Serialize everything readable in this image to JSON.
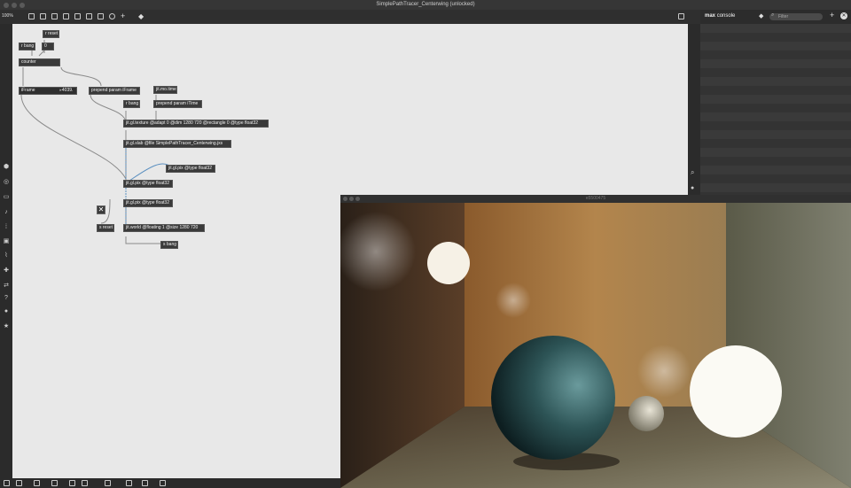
{
  "window": {
    "title": "SimplePathTracer_Centerwing (unlocked)"
  },
  "toolbar": {
    "zoom": "100%"
  },
  "console": {
    "title_bold": "max",
    "title_rest": "console",
    "filter_placeholder": "Filter"
  },
  "patch": {
    "objects": [
      {
        "name": "r-reset",
        "text": "r reset"
      },
      {
        "name": "r-bang-1",
        "text": "r bang"
      },
      {
        "name": "number-0",
        "text": "0"
      },
      {
        "name": "counter",
        "text": "counter"
      },
      {
        "name": "iframe-label",
        "text": "iFrame"
      },
      {
        "name": "iframe-value",
        "text": "4039."
      },
      {
        "name": "prepend-iframe",
        "text": "prepend param iFrame"
      },
      {
        "name": "jit-mo-time",
        "text": "jit.mo.time"
      },
      {
        "name": "r-bang-2",
        "text": "r bang"
      },
      {
        "name": "prepend-itime",
        "text": "prepend param iTime"
      },
      {
        "name": "jit-gl-texture",
        "text": "jit.gl.texture @adapt 0 @dim 1280 720 @rectangle 0 @type float32"
      },
      {
        "name": "jit-gl-slab",
        "text": "jit.gl.slab @file SimplePathTracer_Centerwing.jxs"
      },
      {
        "name": "jit-gl-pix-1",
        "text": "jit.gl.pix @type float32"
      },
      {
        "name": "jit-gl-pix-2",
        "text": "jit.gl.pix @type float32"
      },
      {
        "name": "jit-gl-pix-3",
        "text": "jit.gl.pix @type float32"
      },
      {
        "name": "s-reset",
        "text": "s reset"
      },
      {
        "name": "jit-world",
        "text": "jit.world @floating 1 @size 1280 720"
      },
      {
        "name": "s-bang",
        "text": "s bang"
      }
    ]
  },
  "render_window": {
    "title": "e5500475"
  },
  "colors": {
    "canvas": "#e8e8e8",
    "object_bg": "#3a3a3a",
    "panel": "#2b2b2b"
  }
}
